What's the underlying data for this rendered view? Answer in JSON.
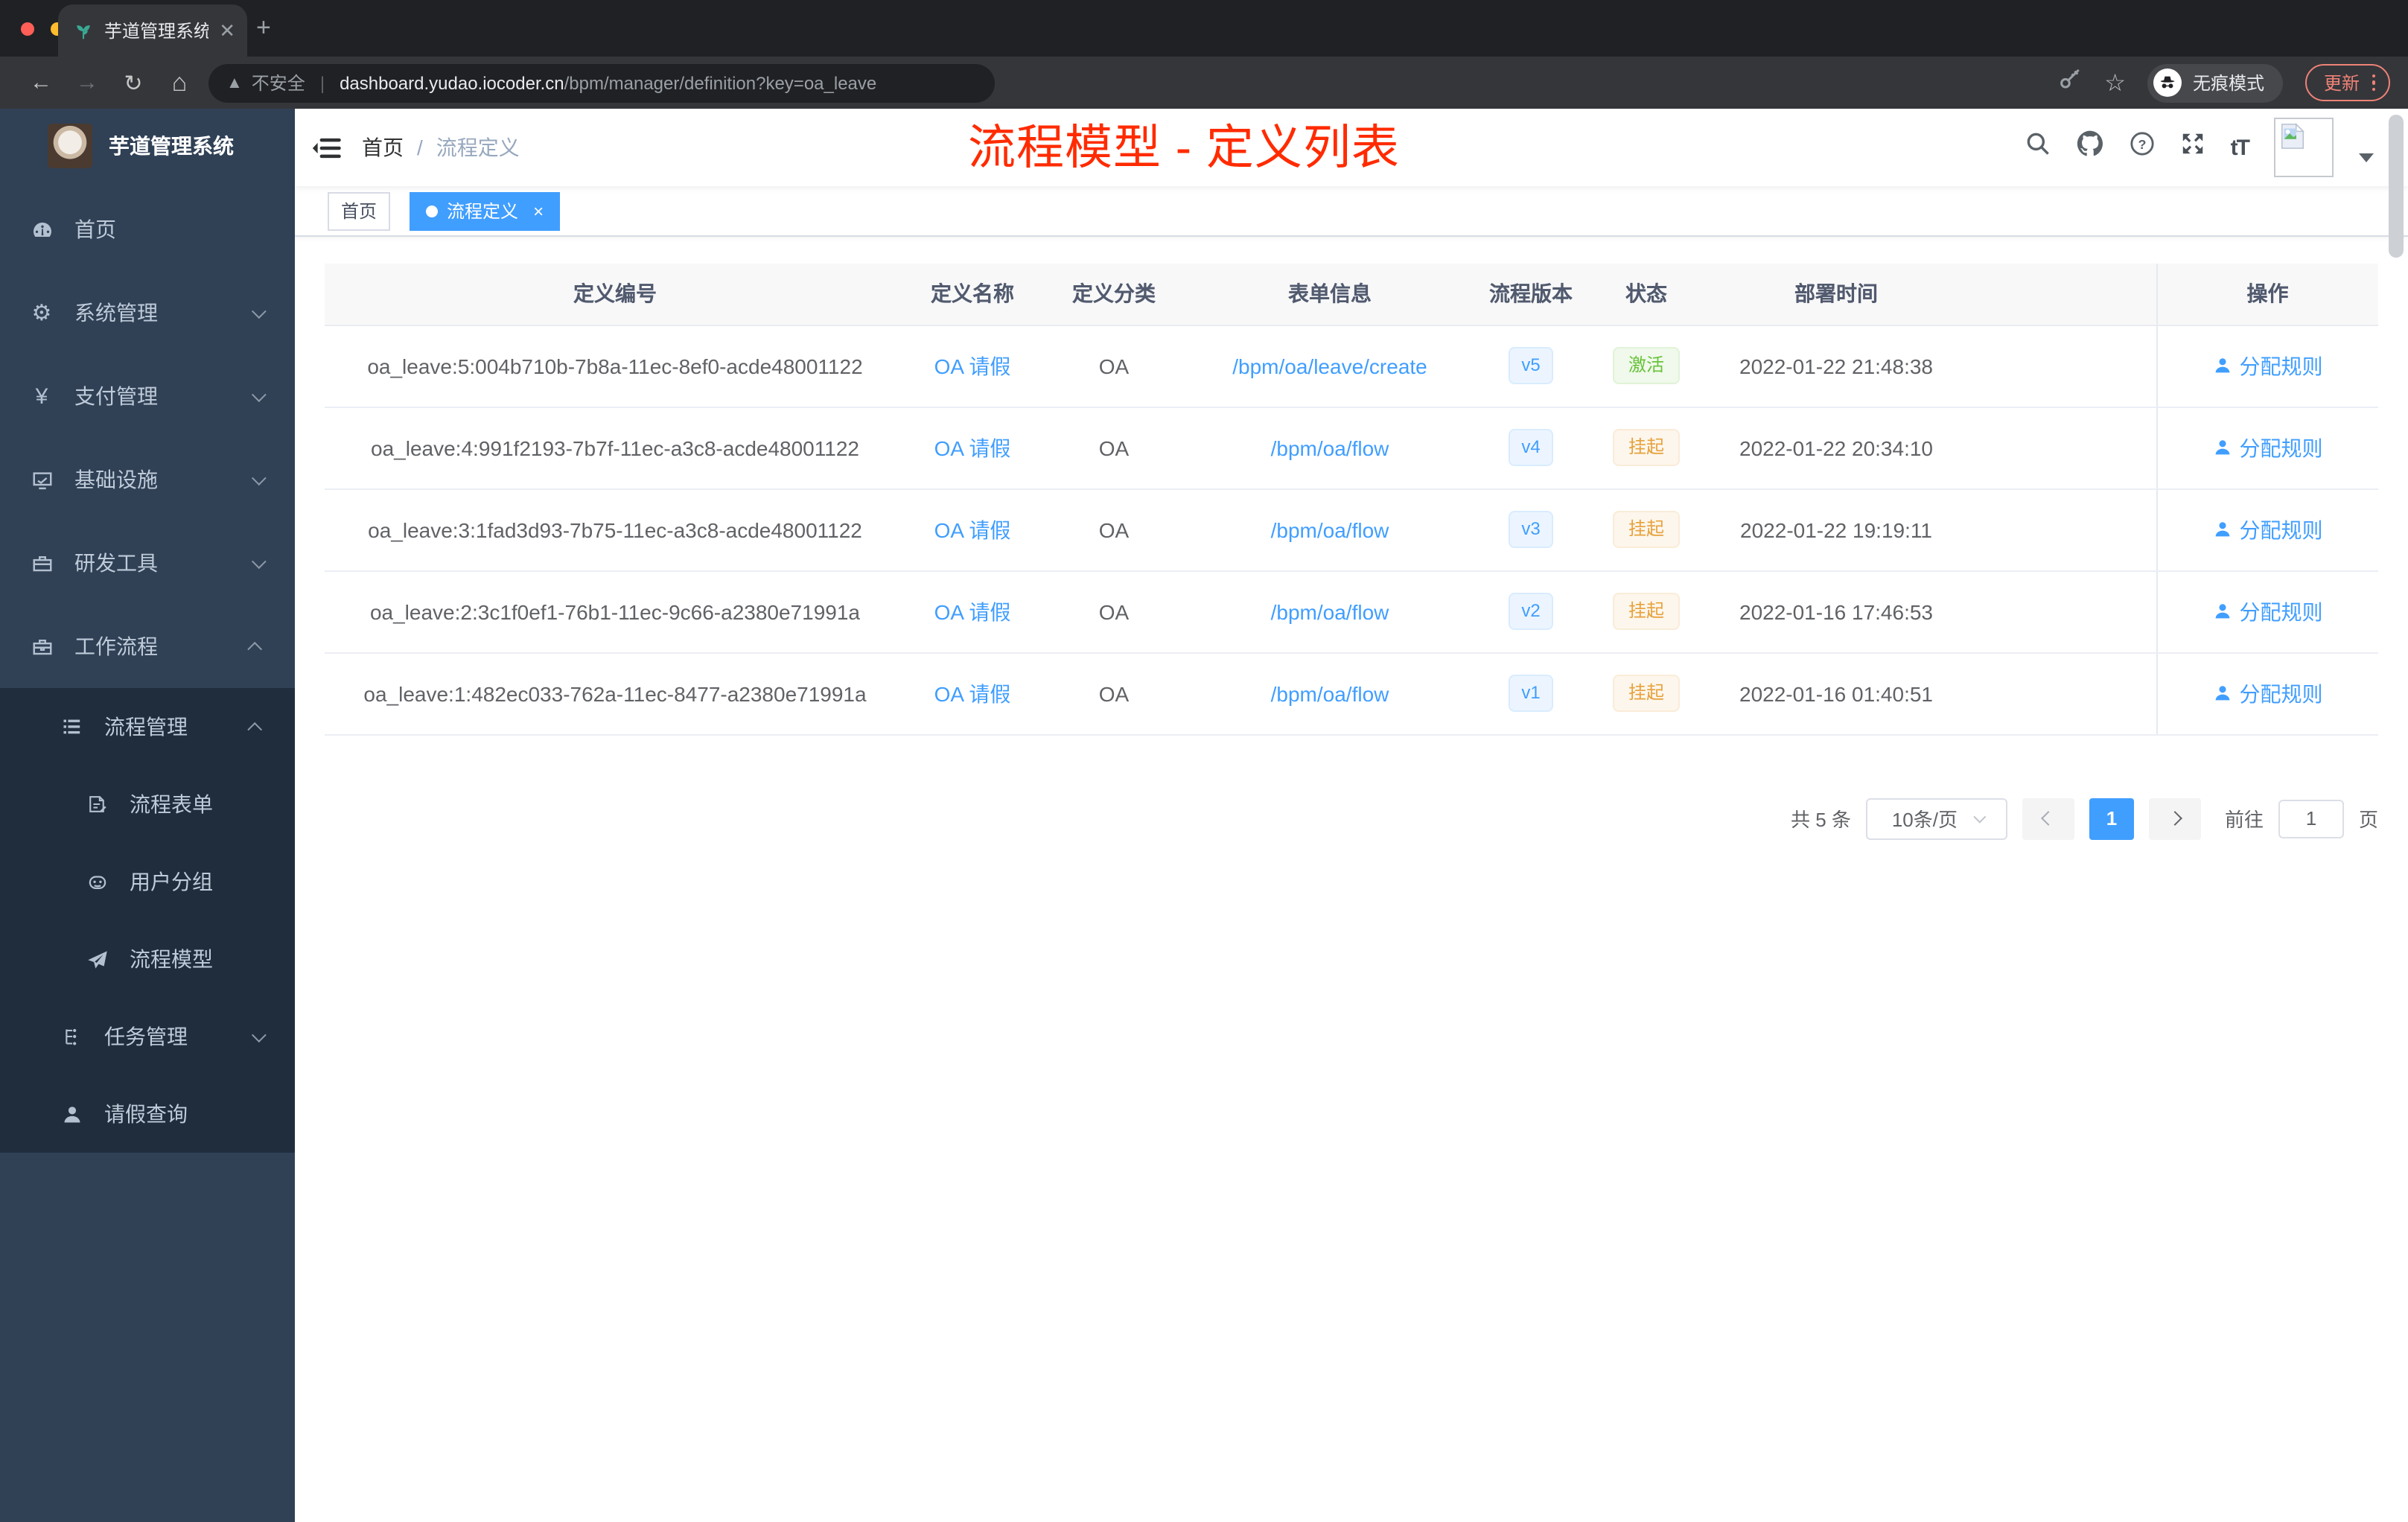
{
  "browser": {
    "tab_title": "芋道管理系统",
    "security_label": "不安全",
    "url_domain": "dashboard.yudao.iocoder.cn",
    "url_path": "/bpm/manager/definition?key=oa_leave",
    "incognito_label": "无痕模式",
    "update_label": "更新"
  },
  "sidebar": {
    "logo_title": "芋道管理系统",
    "items": [
      {
        "icon": "dashboard",
        "label": "首页",
        "chevron": null
      },
      {
        "icon": "gear",
        "label": "系统管理",
        "chevron": "down"
      },
      {
        "icon": "yen",
        "label": "支付管理",
        "chevron": "down"
      },
      {
        "icon": "monitor",
        "label": "基础设施",
        "chevron": "down"
      },
      {
        "icon": "toolbox",
        "label": "研发工具",
        "chevron": "down"
      },
      {
        "icon": "briefcase",
        "label": "工作流程",
        "chevron": "up"
      }
    ],
    "submenu": [
      {
        "icon": "list",
        "label": "流程管理",
        "chevron": "up",
        "level": 1
      },
      {
        "icon": "form",
        "label": "流程表单",
        "chevron": null,
        "level": 2
      },
      {
        "icon": "robot",
        "label": "用户分组",
        "chevron": null,
        "level": 2
      },
      {
        "icon": "send",
        "label": "流程模型",
        "chevron": null,
        "level": 2
      },
      {
        "icon": "tree",
        "label": "任务管理",
        "chevron": "down",
        "level": 1
      },
      {
        "icon": "user",
        "label": "请假查询",
        "chevron": null,
        "level": 1
      }
    ]
  },
  "header": {
    "breadcrumb_home": "首页",
    "breadcrumb_current": "流程定义",
    "overlay_title": "流程模型 - 定义列表",
    "overlay_color": "#ff2b00"
  },
  "tags": [
    {
      "label": "首页",
      "active": false,
      "closable": false
    },
    {
      "label": "流程定义",
      "active": true,
      "closable": true
    }
  ],
  "table": {
    "columns": [
      "定义编号",
      "定义名称",
      "定义分类",
      "表单信息",
      "流程版本",
      "状态",
      "部署时间",
      "操作"
    ],
    "action_label": "分配规则",
    "rows": [
      {
        "id": "oa_leave:5:004b710b-7b8a-11ec-8ef0-acde48001122",
        "name": "OA 请假",
        "category": "OA",
        "form": "/bpm/oa/leave/create",
        "version": "v5",
        "status": "激活",
        "status_type": "success",
        "time": "2022-01-22 21:48:38"
      },
      {
        "id": "oa_leave:4:991f2193-7b7f-11ec-a3c8-acde48001122",
        "name": "OA 请假",
        "category": "OA",
        "form": "/bpm/oa/flow",
        "version": "v4",
        "status": "挂起",
        "status_type": "warning",
        "time": "2022-01-22 20:34:10"
      },
      {
        "id": "oa_leave:3:1fad3d93-7b75-11ec-a3c8-acde48001122",
        "name": "OA 请假",
        "category": "OA",
        "form": "/bpm/oa/flow",
        "version": "v3",
        "status": "挂起",
        "status_type": "warning",
        "time": "2022-01-22 19:19:11"
      },
      {
        "id": "oa_leave:2:3c1f0ef1-76b1-11ec-9c66-a2380e71991a",
        "name": "OA 请假",
        "category": "OA",
        "form": "/bpm/oa/flow",
        "version": "v2",
        "status": "挂起",
        "status_type": "warning",
        "time": "2022-01-16 17:46:53"
      },
      {
        "id": "oa_leave:1:482ec033-762a-11ec-8477-a2380e71991a",
        "name": "OA 请假",
        "category": "OA",
        "form": "/bpm/oa/flow",
        "version": "v1",
        "status": "挂起",
        "status_type": "warning",
        "time": "2022-01-16 01:40:51"
      }
    ]
  },
  "pagination": {
    "total_label": "共 5 条",
    "page_size_label": "10条/页",
    "current_page": "1",
    "goto_label": "前往",
    "goto_value": "1",
    "page_unit_label": "页"
  },
  "colors": {
    "primary": "#409eff",
    "success": "#67c23a",
    "warning": "#e6a23c",
    "annotation_red": "#ff2b00"
  }
}
